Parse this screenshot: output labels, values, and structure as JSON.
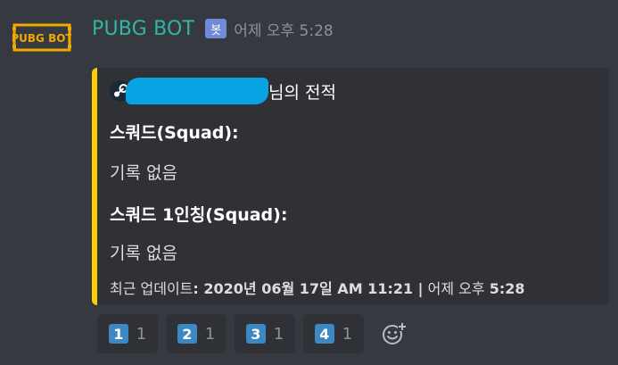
{
  "message": {
    "avatar_text": "PUBG BOT",
    "author": "PUBG BOT",
    "bot_tag": "봇",
    "timestamp": "어제 오후 5:28"
  },
  "embed": {
    "accent_color": "#f9cc08",
    "author_suffix": "님의 전적",
    "fields": [
      {
        "name": "스쿼드(Squad):",
        "value": "기록 없음"
      },
      {
        "name": "스쿼드 1인칭(Squad):",
        "value": "기록 없음"
      }
    ],
    "footer_prefix": "최근 업데이트",
    "footer_date": ": 2020년 06월 17일 AM 11:21 |",
    "footer_time_prefix": "어제 오후",
    "footer_time": "5:28"
  },
  "reactions": [
    {
      "emoji": "1",
      "count": "1"
    },
    {
      "emoji": "2",
      "count": "1"
    },
    {
      "emoji": "3",
      "count": "1"
    },
    {
      "emoji": "4",
      "count": "1"
    }
  ],
  "icons": {
    "avatar": "pubg-logo-icon",
    "author": "steam-icon",
    "add_reaction": "add-reaction-icon"
  }
}
